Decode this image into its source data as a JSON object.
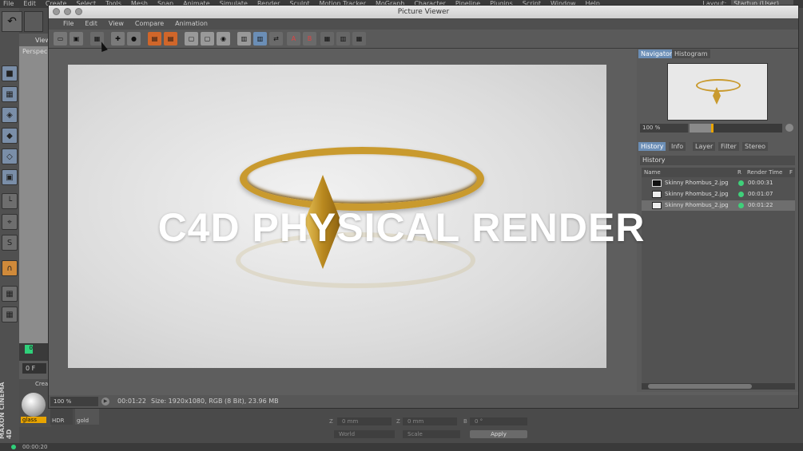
{
  "app_menu": [
    "File",
    "Edit",
    "Create",
    "Select",
    "Tools",
    "Mesh",
    "Snap",
    "Animate",
    "Simulate",
    "Render",
    "Sculpt",
    "Motion Tracker",
    "MoGraph",
    "Character",
    "Pipeline",
    "Plugins",
    "Script",
    "Window",
    "Help"
  ],
  "layout": {
    "label": "Layout:",
    "value": "Startup (User)"
  },
  "viewport": {
    "view_label": "View",
    "perspective_label": "Perspec",
    "frame_value": "0",
    "frame_field": "0 F",
    "material_panel_label": "Crea"
  },
  "materials": [
    {
      "name": "glass"
    },
    {
      "name": "HDR"
    },
    {
      "name": "gold"
    }
  ],
  "brand": "MAXON CINEMA 4D",
  "attributes": {
    "labels": [
      "Z",
      "Z",
      "B"
    ],
    "values": [
      "0 mm",
      "0 mm",
      "0 °"
    ],
    "coordinate_mode": "World",
    "transform_mode": "Scale",
    "apply_label": "Apply"
  },
  "bottom_status": {
    "time": "00:00:20"
  },
  "picture_viewer": {
    "title": "Picture Viewer",
    "menu": [
      "File",
      "Edit",
      "View",
      "Compare",
      "Animation"
    ],
    "toolbar_icons": [
      "open-icon",
      "save-icon",
      "grid-icon",
      "crop-icon",
      "snapshot-icon",
      "layers-icon",
      "layers-alt-icon",
      "render-region-icon",
      "render-region-alt-icon",
      "render-view-icon",
      "ab-compare-icon",
      "swap-icon",
      "ab-swap-icon",
      "set-a-icon",
      "set-b-icon",
      "stereo-icon",
      "split-icon",
      "channel-icon"
    ],
    "status": {
      "zoom": "100 %",
      "time": "00:01:22",
      "info": "Size: 1920x1080, RGB (8 Bit), 23.96 MB"
    }
  },
  "overlay_text": "C4D PHYSICAL RENDER",
  "side_panel": {
    "top_tabs": [
      "Navigator",
      "Histogram"
    ],
    "nav_zoom": "100 %",
    "bottom_tabs": [
      "History",
      "Info",
      "Layer",
      "Filter",
      "Stereo"
    ],
    "history_title": "History",
    "columns": [
      "Name",
      "R",
      "Render Time",
      "F"
    ],
    "rows": [
      {
        "name": "Skinny Rhombus_2.jpg",
        "time": "00:00:31"
      },
      {
        "name": "Skinny Rhombus_2.jpg",
        "time": "00:01:07"
      },
      {
        "name": "Skinny Rhombus_2.jpg",
        "time": "00:01:22"
      }
    ]
  }
}
